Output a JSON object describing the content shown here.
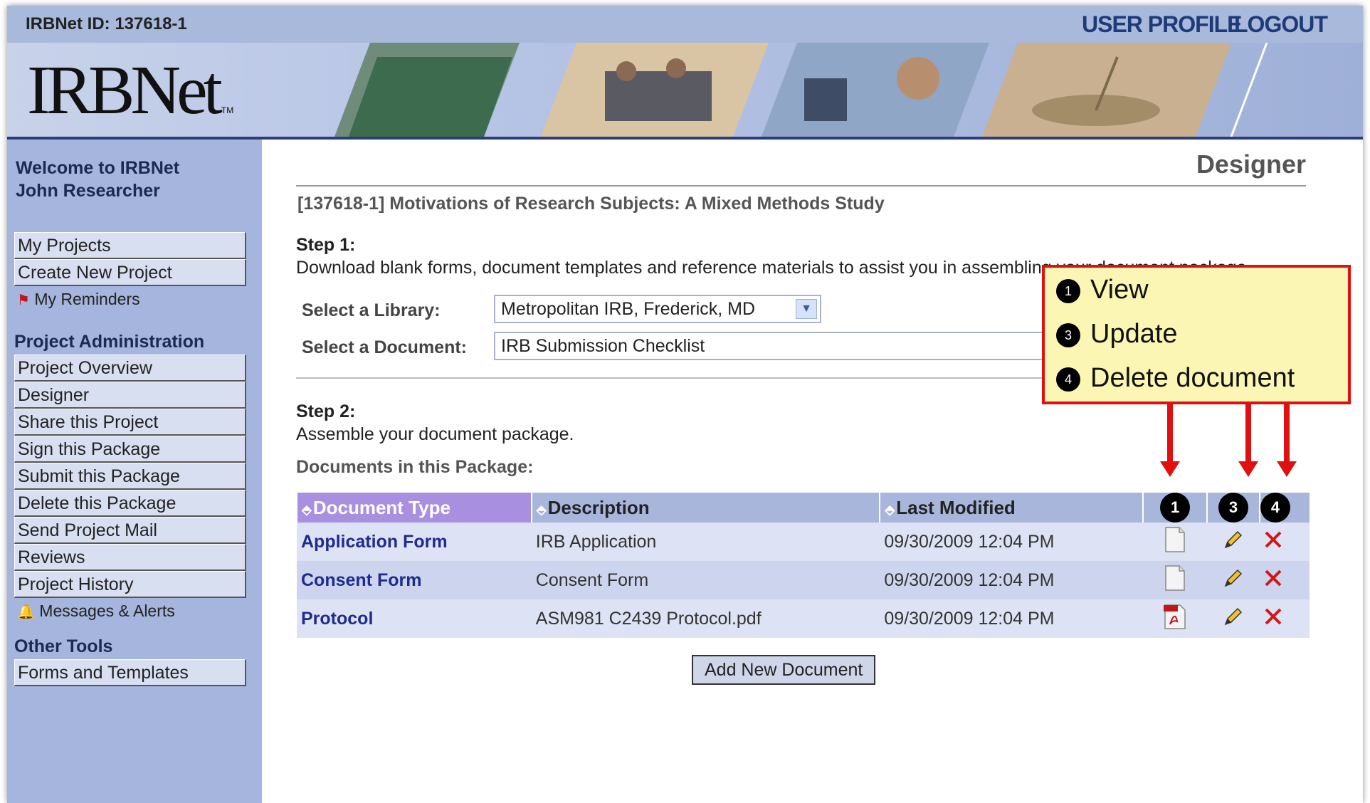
{
  "topbar": {
    "irbnet_id": "IRBNet ID: 137618-1",
    "user_profile": "USER PROFILE",
    "logout": "LOGOUT"
  },
  "banner": {
    "logo_text": "IRBNet",
    "logo_tm": "TM"
  },
  "sidebar": {
    "welcome_line1": "Welcome to IRBNet",
    "welcome_line2": "John Researcher",
    "top_items": [
      "My Projects",
      "Create New Project"
    ],
    "reminders": "My Reminders",
    "project_admin_heading": "Project Administration",
    "admin_items": [
      "Project Overview",
      "Designer",
      "Share this Project",
      "Sign this Package",
      "Submit this Package",
      "Delete this Package",
      "Send Project Mail",
      "Reviews",
      "Project History"
    ],
    "messages": "Messages & Alerts",
    "other_tools_heading": "Other Tools",
    "tools_items": [
      "Forms and Templates"
    ]
  },
  "main": {
    "page_heading": "Designer",
    "project_title": "[137618-1] Motivations of Research Subjects: A Mixed Methods Study",
    "step1_label": "Step 1:",
    "step1_text": "Download blank forms, document templates and reference materials to assist you in assembling your document package.",
    "library_label": "Select a Library:",
    "library_value": "Metropolitan IRB, Frederick, MD",
    "document_label": "Select a Document:",
    "document_value": "IRB Submission Checklist",
    "step2_label": "Step 2:",
    "step2_text": "Assemble your document package.",
    "docs_label": "Documents in this Package:",
    "add_button": "Add New Document"
  },
  "table": {
    "headers": [
      "Document Type",
      "Description",
      "Last Modified"
    ],
    "header_badges": [
      "1",
      "3",
      "4"
    ],
    "rows": [
      {
        "type": "Application Form",
        "description": "IRB Application",
        "modified": "09/30/2009 12:04 PM",
        "file_icon": "document-icon"
      },
      {
        "type": "Consent Form",
        "description": "Consent Form",
        "modified": "09/30/2009 12:04 PM",
        "file_icon": "document-icon"
      },
      {
        "type": "Protocol",
        "description": "ASM981 C2439 Protocol.pdf",
        "modified": "09/30/2009 12:04 PM",
        "file_icon": "pdf-icon"
      }
    ]
  },
  "legend": {
    "items": [
      {
        "badge": "1",
        "label": "View"
      },
      {
        "badge": "3",
        "label": "Update"
      },
      {
        "badge": "4",
        "label": "Delete document"
      }
    ]
  },
  "colors": {
    "accent_red": "#e01010",
    "nav_blue": "#a5b5dd",
    "link_blue": "#1e2b8f",
    "sorted_header": "#a98fe0",
    "legend_bg": "#fbf6b4"
  }
}
